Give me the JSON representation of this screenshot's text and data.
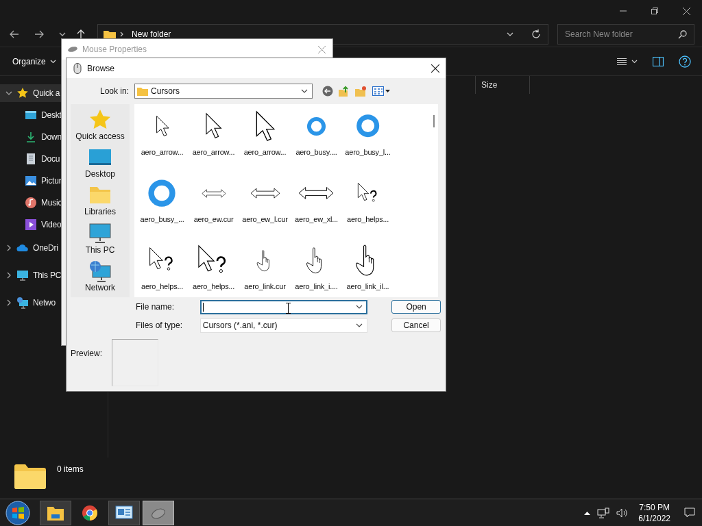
{
  "explorer": {
    "address": {
      "path": "New folder"
    },
    "search": {
      "placeholder": "Search New folder"
    },
    "toolbar": {
      "organize": "Organize"
    },
    "columns": [
      "Size"
    ],
    "sidebar": [
      {
        "label": "Quick a",
        "expanded": true,
        "selected": true,
        "children": [
          {
            "label": "Deskt",
            "selected": false
          },
          {
            "label": "Down",
            "selected": false
          },
          {
            "label": "Docu",
            "selected": false
          },
          {
            "label": "Pictur",
            "selected": false
          },
          {
            "label": "Music",
            "selected": false
          },
          {
            "label": "Video",
            "selected": false
          }
        ]
      },
      {
        "label": "OneDri",
        "expanded": false,
        "selected": false
      },
      {
        "label": "This PC",
        "expanded": false,
        "selected": false
      },
      {
        "label": "Netwo",
        "expanded": false,
        "selected": false
      }
    ],
    "status_bar": {
      "count": "0 items"
    }
  },
  "mouse_properties": {
    "title": "Mouse Properties"
  },
  "browse": {
    "title": "Browse",
    "look_in_label": "Look in:",
    "look_in": "Cursors",
    "places": [
      {
        "label": "Quick access"
      },
      {
        "label": "Desktop"
      },
      {
        "label": "Libraries"
      },
      {
        "label": "This PC"
      },
      {
        "label": "Network"
      }
    ],
    "files": [
      {
        "name": "aero_arrow...",
        "kind": "arrow"
      },
      {
        "name": "aero_arrow...",
        "kind": "arrow"
      },
      {
        "name": "aero_arrow...",
        "kind": "arrow"
      },
      {
        "name": "aero_busy....",
        "kind": "busy"
      },
      {
        "name": "aero_busy_l...",
        "kind": "busy"
      },
      {
        "name": "aero_busy_...",
        "kind": "busy"
      },
      {
        "name": "aero_ew.cur",
        "kind": "ew"
      },
      {
        "name": "aero_ew_l.cur",
        "kind": "ew"
      },
      {
        "name": "aero_ew_xl...",
        "kind": "ew"
      },
      {
        "name": "aero_helps...",
        "kind": "help"
      },
      {
        "name": "aero_helps...",
        "kind": "help"
      },
      {
        "name": "aero_helps...",
        "kind": "help"
      },
      {
        "name": "aero_link.cur",
        "kind": "link"
      },
      {
        "name": "aero_link_i....",
        "kind": "link"
      },
      {
        "name": "aero_link_il...",
        "kind": "link"
      }
    ],
    "file_name_label": "File name:",
    "file_name_focused": true,
    "file_type_label": "Files of type:",
    "file_type": "Cursors (*.ani, *.cur)",
    "buttons": [
      {
        "label": "Open",
        "default": true
      },
      {
        "label": "Cancel",
        "default": false
      }
    ],
    "preview_label": "Preview:"
  },
  "taskbar": {
    "apps": [
      {
        "selected": false
      },
      {
        "selected": false
      },
      {
        "selected": false
      },
      {
        "selected": true
      }
    ],
    "clock": {
      "time": "7:50 PM",
      "date": "6/1/2022"
    }
  }
}
